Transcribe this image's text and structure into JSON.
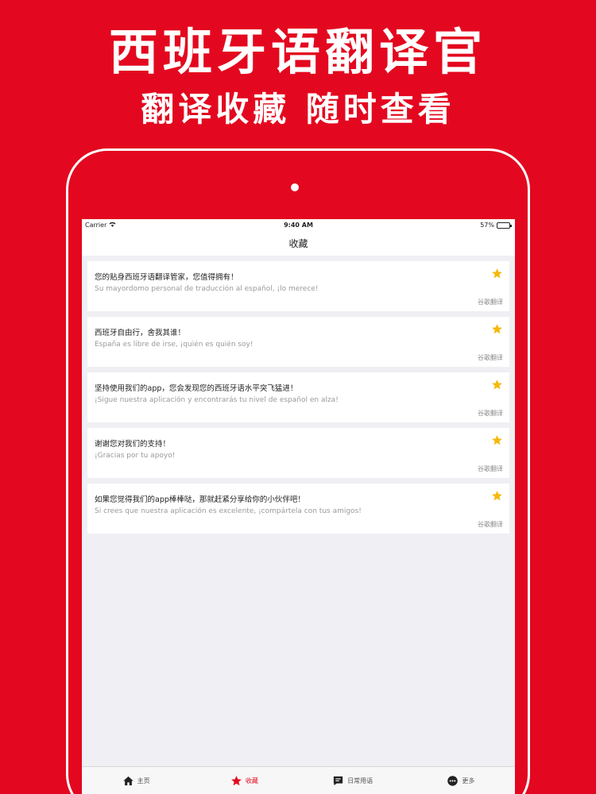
{
  "promo": {
    "title": "西班牙语翻译官",
    "subtitle": "翻译收藏 随时查看"
  },
  "status_bar": {
    "carrier": "Carrier",
    "time": "9:40 AM",
    "battery": "57%",
    "battery_level": 0.57
  },
  "nav": {
    "title": "收藏"
  },
  "favorites": [
    {
      "zh": "您的贴身西班牙语翻译管家，您值得拥有！",
      "es": "Su mayordomo personal de traducción al español, ¡lo merece!",
      "source": "谷歌翻译"
    },
    {
      "zh": "西班牙自由行，舍我其谁！",
      "es": "España es libre de irse, ¡quién es quién soy!",
      "source": "谷歌翻译"
    },
    {
      "zh": "坚持使用我们的app，您会发现您的西班牙语水平突飞猛进！",
      "es": "¡Sigue nuestra aplicación y encontrarás tu nivel de español en alza!",
      "source": "谷歌翻译"
    },
    {
      "zh": "谢谢您对我们的支持！",
      "es": "¡Gracias por tu apoyo!",
      "source": "谷歌翻译"
    },
    {
      "zh": "如果您觉得我们的app棒棒哒，那就赶紧分享给你的小伙伴吧！",
      "es": "Si crees que nuestra aplicación es excelente, ¡compártela con tus amigos!",
      "source": "谷歌翻译"
    }
  ],
  "tabs": [
    {
      "label": "主页",
      "icon": "home-icon",
      "active": false
    },
    {
      "label": "收藏",
      "icon": "star-icon",
      "active": true
    },
    {
      "label": "日常用语",
      "icon": "chat-icon",
      "active": false
    },
    {
      "label": "更多",
      "icon": "more-icon",
      "active": false
    }
  ],
  "colors": {
    "brand_red": "#e3081f",
    "star_yellow": "#f5b80c",
    "list_background": "#efeff4"
  }
}
